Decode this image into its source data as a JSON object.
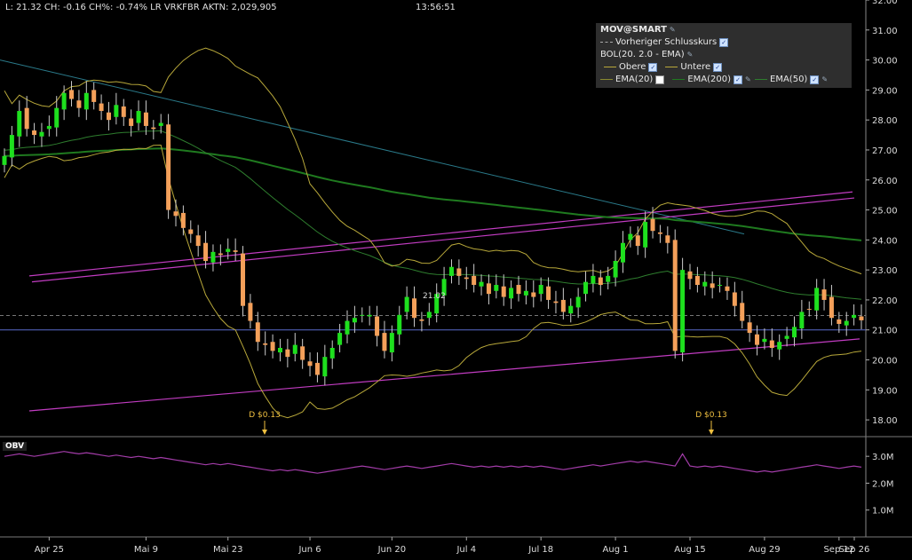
{
  "header": {
    "quote": "L: 21.32 CH: -0.16 CH%: -0.74% LR VRKFBR AKTN: 2,029,905",
    "time": "13:56:51"
  },
  "legend": {
    "title": "MOV@SMART",
    "prev_close": "Vorheriger Schlusskurs",
    "bol": "BOL(20. 2.0 - EMA)",
    "obere": "Obere",
    "untere": "Untere",
    "ema20": "EMA(20)",
    "ema200": "EMA(200)",
    "ema50": "EMA(50)"
  },
  "obv_label": "OBV",
  "colors": {
    "up": "#1ee01e",
    "down": "#f4a05a",
    "bollinger": "#b8a83a",
    "ema20": "#8a8a30",
    "ema200": "#1f7a1f",
    "ema50": "#2e7d2e",
    "trendline": "#c13cc1",
    "downtrend": "#2a7a8a",
    "obv": "#a23ca8",
    "last_price": "#5a6acc"
  },
  "chart_data": [
    {
      "type": "candlestick",
      "yticks": [
        "18.00",
        "19.00",
        "20.00",
        "21.00",
        "22.00",
        "23.00",
        "24.00",
        "25.00",
        "26.00",
        "27.00",
        "28.00",
        "29.00",
        "30.00",
        "31.00",
        "32.00"
      ],
      "ylim": [
        17.5,
        32
      ],
      "xticks": [
        "Apr 25",
        "Mai 9",
        "Mai 23",
        "Jun 6",
        "Jun 20",
        "Jul 4",
        "Jul 18",
        "Aug 1",
        "Aug 15",
        "Aug 29",
        "Sep 12",
        "Sep 26"
      ],
      "last_price": 21.0,
      "prev_close": 21.48,
      "dividends": [
        {
          "label": "D $0.13",
          "x": "Jun 6"
        },
        {
          "label": "D $0.13",
          "x": "Aug 29"
        }
      ],
      "annotation": "21.02",
      "closes": [
        26.8,
        27.5,
        28.3,
        27.7,
        27.5,
        27.6,
        27.8,
        28.4,
        28.9,
        28.7,
        28.4,
        28.9,
        28.6,
        28.3,
        28.0,
        28.5,
        28.1,
        27.8,
        28.3,
        27.8,
        27.7,
        27.9,
        25.0,
        24.8,
        24.4,
        24.2,
        23.8,
        23.3,
        23.6,
        23.5,
        23.7,
        23.6,
        21.8,
        21.3,
        20.6,
        20.5,
        20.3,
        20.4,
        20.1,
        20.5,
        20.0,
        19.8,
        19.5,
        20.1,
        20.4,
        20.9,
        21.3,
        21.4,
        21.5,
        21.5,
        20.8,
        20.3,
        20.9,
        21.5,
        22.1,
        21.4,
        21.3,
        21.6,
        22.2,
        22.7,
        23.1,
        22.8,
        22.7,
        22.5,
        22.6,
        22.2,
        22.5,
        22.1,
        22.4,
        22.2,
        22.3,
        22.1,
        22.5,
        22.0,
        21.9,
        21.6,
        21.8,
        22.1,
        22.6,
        22.8,
        22.5,
        22.8,
        23.3,
        23.9,
        24.2,
        23.8,
        24.6,
        24.3,
        24.2,
        23.9,
        20.3,
        23.0,
        22.7,
        22.5,
        22.6,
        22.4,
        22.5,
        22.3,
        21.8,
        21.3,
        20.9,
        20.5,
        20.7,
        20.4,
        20.6,
        20.8,
        21.1,
        21.6,
        21.7,
        22.4,
        22.0,
        21.4,
        21.2,
        21.3,
        21.5,
        21.32
      ],
      "obv_yticks": [
        "1.0M",
        "2.0M",
        "3.0M"
      ],
      "obv_ylim": [
        0,
        3.6
      ]
    }
  ]
}
